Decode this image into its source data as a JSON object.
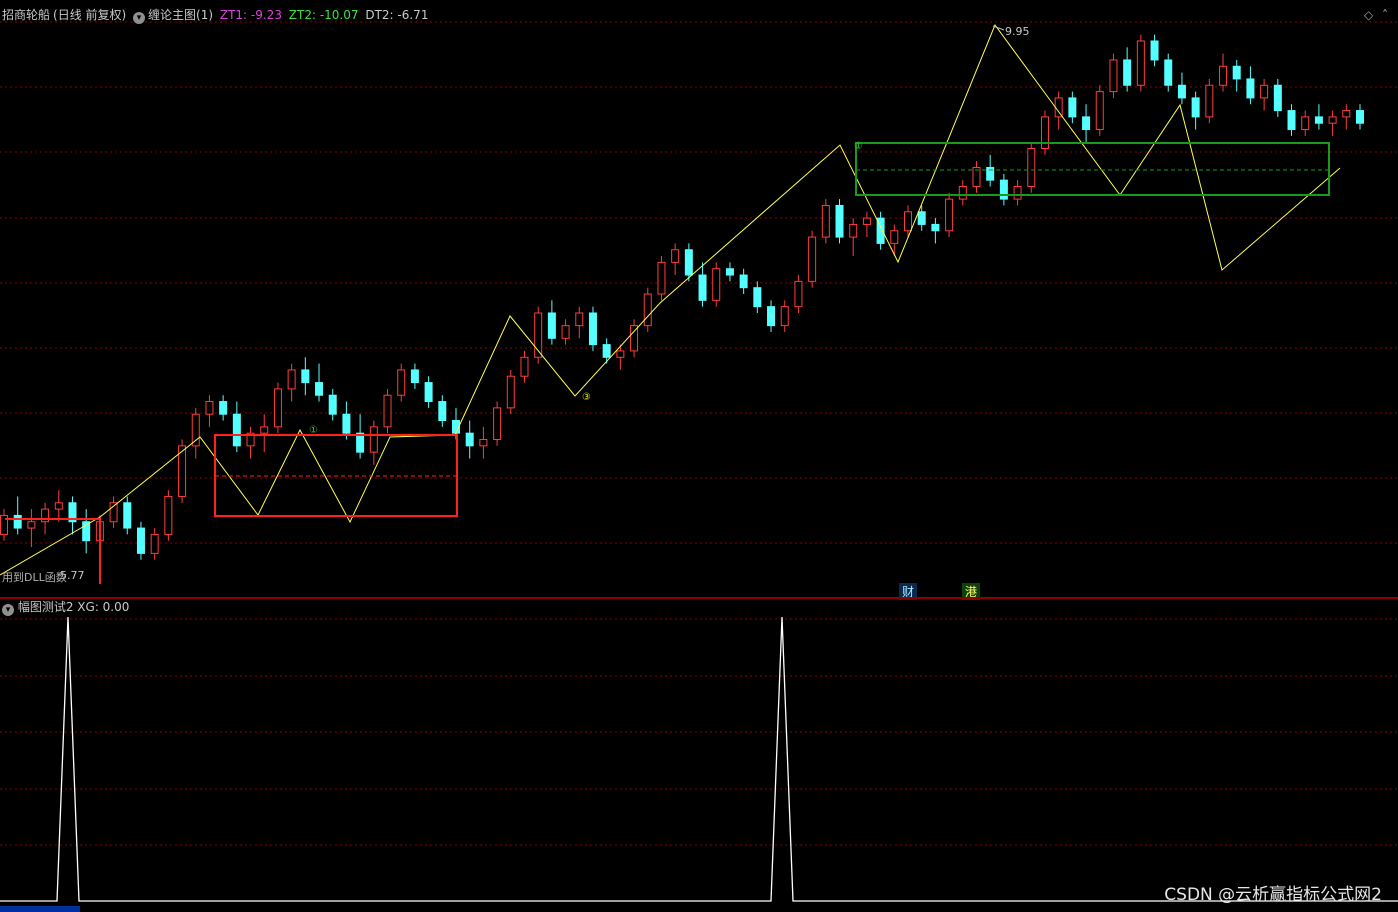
{
  "header": {
    "stock_name": "招商轮船",
    "period": "(日线 前复权)",
    "indicator_name": "缠论主图(1)",
    "zt1_label": "ZT1: -9.23",
    "zt2_label": "ZT2: -10.07",
    "dt2_label": "DT2: -6.71"
  },
  "main_chart": {
    "peak_label": "9.95",
    "low_label": "5.77",
    "dll_note": "用到DLL函数",
    "marker_1": "①",
    "marker_3": "③",
    "tag_cai": "财",
    "tag_gang": "港"
  },
  "sub_chart": {
    "title": "幅图测试2",
    "xg_label": "XG: 0.00"
  },
  "watermark": "CSDN @云析赢指标公式网2",
  "colors": {
    "up": "#ff3c3c",
    "down": "#54ffff",
    "zigzag": "#ffff50",
    "box_red": "#ff2020",
    "box_green": "#1a9a1a",
    "grid": "#8b0000"
  },
  "candles": [
    [
      6.0,
      6.2,
      5.95,
      6.15
    ],
    [
      6.15,
      6.3,
      6.0,
      6.05
    ],
    [
      6.05,
      6.2,
      5.9,
      6.1
    ],
    [
      6.1,
      6.25,
      6.0,
      6.2
    ],
    [
      6.2,
      6.35,
      6.1,
      6.25
    ],
    [
      6.25,
      6.3,
      6.0,
      6.1
    ],
    [
      6.1,
      6.2,
      5.85,
      5.95
    ],
    [
      5.95,
      6.15,
      5.9,
      6.1
    ],
    [
      6.1,
      6.3,
      6.05,
      6.25
    ],
    [
      6.25,
      6.3,
      6.0,
      6.05
    ],
    [
      6.05,
      6.1,
      5.8,
      5.85
    ],
    [
      5.85,
      6.05,
      5.8,
      6.0
    ],
    [
      6.0,
      6.35,
      5.95,
      6.3
    ],
    [
      6.3,
      6.75,
      6.25,
      6.7
    ],
    [
      6.7,
      7.0,
      6.6,
      6.95
    ],
    [
      6.95,
      7.1,
      6.85,
      7.05
    ],
    [
      7.05,
      7.1,
      6.9,
      6.95
    ],
    [
      6.95,
      7.05,
      6.65,
      6.7
    ],
    [
      6.7,
      6.85,
      6.6,
      6.8
    ],
    [
      6.8,
      6.95,
      6.65,
      6.85
    ],
    [
      6.85,
      7.2,
      6.8,
      7.15
    ],
    [
      7.15,
      7.35,
      7.05,
      7.3
    ],
    [
      7.3,
      7.4,
      7.1,
      7.2
    ],
    [
      7.2,
      7.35,
      7.05,
      7.1
    ],
    [
      7.1,
      7.15,
      6.9,
      6.95
    ],
    [
      6.95,
      7.05,
      6.75,
      6.8
    ],
    [
      6.8,
      6.95,
      6.6,
      6.65
    ],
    [
      6.65,
      6.9,
      6.55,
      6.85
    ],
    [
      6.85,
      7.15,
      6.8,
      7.1
    ],
    [
      7.1,
      7.35,
      7.05,
      7.3
    ],
    [
      7.3,
      7.35,
      7.15,
      7.2
    ],
    [
      7.2,
      7.25,
      7.0,
      7.05
    ],
    [
      7.05,
      7.1,
      6.85,
      6.9
    ],
    [
      6.9,
      7.0,
      6.75,
      6.8
    ],
    [
      6.8,
      6.9,
      6.6,
      6.7
    ],
    [
      6.7,
      6.85,
      6.6,
      6.75
    ],
    [
      6.75,
      7.05,
      6.7,
      7.0
    ],
    [
      7.0,
      7.3,
      6.95,
      7.25
    ],
    [
      7.25,
      7.45,
      7.2,
      7.4
    ],
    [
      7.4,
      7.8,
      7.35,
      7.75
    ],
    [
      7.75,
      7.85,
      7.5,
      7.55
    ],
    [
      7.55,
      7.7,
      7.5,
      7.65
    ],
    [
      7.65,
      7.8,
      7.55,
      7.75
    ],
    [
      7.75,
      7.8,
      7.45,
      7.5
    ],
    [
      7.5,
      7.55,
      7.35,
      7.4
    ],
    [
      7.4,
      7.5,
      7.3,
      7.45
    ],
    [
      7.45,
      7.7,
      7.4,
      7.65
    ],
    [
      7.65,
      7.95,
      7.6,
      7.9
    ],
    [
      7.9,
      8.2,
      7.85,
      8.15
    ],
    [
      8.15,
      8.3,
      8.05,
      8.25
    ],
    [
      8.25,
      8.3,
      8.0,
      8.05
    ],
    [
      8.05,
      8.15,
      7.8,
      7.85
    ],
    [
      7.85,
      8.15,
      7.8,
      8.1
    ],
    [
      8.1,
      8.15,
      8.0,
      8.05
    ],
    [
      8.05,
      8.1,
      7.9,
      7.95
    ],
    [
      7.95,
      8.0,
      7.75,
      7.8
    ],
    [
      7.8,
      7.85,
      7.6,
      7.65
    ],
    [
      7.65,
      7.85,
      7.6,
      7.8
    ],
    [
      7.8,
      8.05,
      7.75,
      8.0
    ],
    [
      8.0,
      8.4,
      7.95,
      8.35
    ],
    [
      8.35,
      8.65,
      8.3,
      8.6
    ],
    [
      8.6,
      8.65,
      8.3,
      8.35
    ],
    [
      8.35,
      8.5,
      8.2,
      8.45
    ],
    [
      8.45,
      8.55,
      8.35,
      8.5
    ],
    [
      8.5,
      8.55,
      8.25,
      8.3
    ],
    [
      8.3,
      8.45,
      8.2,
      8.4
    ],
    [
      8.4,
      8.6,
      8.35,
      8.55
    ],
    [
      8.55,
      8.6,
      8.4,
      8.45
    ],
    [
      8.45,
      8.5,
      8.3,
      8.4
    ],
    [
      8.4,
      8.7,
      8.35,
      8.65
    ],
    [
      8.65,
      8.8,
      8.6,
      8.75
    ],
    [
      8.75,
      8.95,
      8.7,
      8.9
    ],
    [
      8.9,
      9.0,
      8.75,
      8.8
    ],
    [
      8.8,
      8.85,
      8.6,
      8.65
    ],
    [
      8.65,
      8.8,
      8.6,
      8.75
    ],
    [
      8.75,
      9.1,
      8.7,
      9.05
    ],
    [
      9.05,
      9.35,
      9.0,
      9.3
    ],
    [
      9.3,
      9.5,
      9.2,
      9.45
    ],
    [
      9.45,
      9.5,
      9.25,
      9.3
    ],
    [
      9.3,
      9.4,
      9.1,
      9.2
    ],
    [
      9.2,
      9.55,
      9.15,
      9.5
    ],
    [
      9.5,
      9.8,
      9.45,
      9.75
    ],
    [
      9.75,
      9.85,
      9.5,
      9.55
    ],
    [
      9.55,
      9.95,
      9.5,
      9.9
    ],
    [
      9.9,
      9.95,
      9.7,
      9.75
    ],
    [
      9.75,
      9.8,
      9.5,
      9.55
    ],
    [
      9.55,
      9.65,
      9.4,
      9.45
    ],
    [
      9.45,
      9.5,
      9.2,
      9.3
    ],
    [
      9.3,
      9.6,
      9.25,
      9.55
    ],
    [
      9.55,
      9.8,
      9.5,
      9.7
    ],
    [
      9.7,
      9.75,
      9.5,
      9.6
    ],
    [
      9.6,
      9.7,
      9.4,
      9.45
    ],
    [
      9.45,
      9.6,
      9.35,
      9.55
    ],
    [
      9.55,
      9.6,
      9.3,
      9.35
    ],
    [
      9.35,
      9.4,
      9.15,
      9.2
    ],
    [
      9.2,
      9.35,
      9.15,
      9.3
    ],
    [
      9.3,
      9.4,
      9.2,
      9.25
    ],
    [
      9.25,
      9.35,
      9.15,
      9.3
    ],
    [
      9.3,
      9.4,
      9.2,
      9.35
    ],
    [
      9.35,
      9.4,
      9.2,
      9.25
    ]
  ],
  "sub_spikes": [
    {
      "label": "left-spike"
    },
    {
      "label": "right-spike"
    }
  ]
}
